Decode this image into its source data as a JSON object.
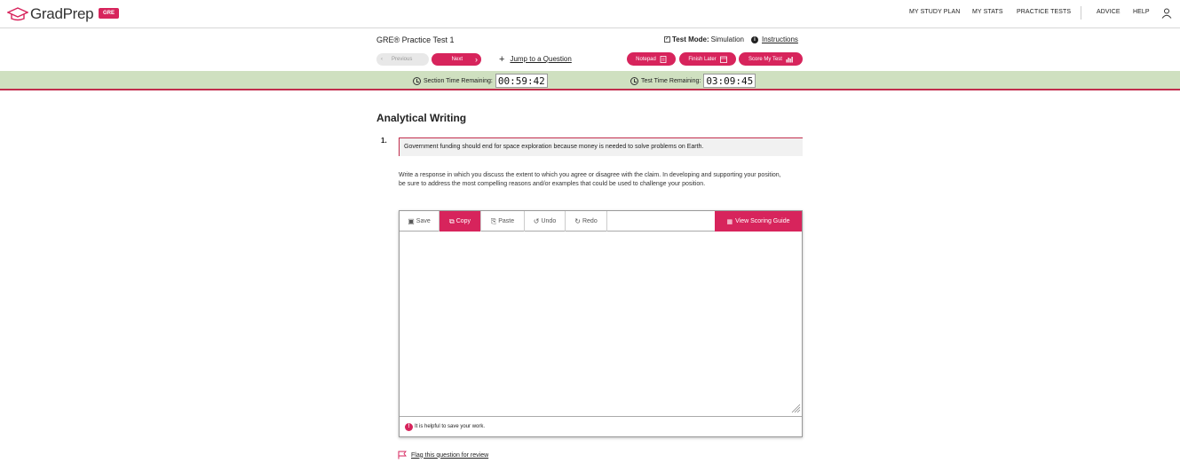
{
  "brand": {
    "logo_text": "GradPrep",
    "badge": "GRE"
  },
  "nav": {
    "items": [
      "MY STUDY PLAN",
      "MY STATS",
      "PRACTICE TESTS",
      "ADVICE",
      "HELP"
    ]
  },
  "test": {
    "title": "GRE® Practice Test 1",
    "mode_label": "Test Mode:",
    "mode_value": "Simulation",
    "instructions": "Instructions",
    "prev_label": "Previous",
    "next_label": "Next",
    "jump_label": "Jump to a Question",
    "notepad_label": "Notepad",
    "finish_label": "Finish Later",
    "score_label": "Score My Test"
  },
  "timers": {
    "section_label": "Section Time Remaining:",
    "section_value": "00:59:42",
    "test_label": "Test Time Remaining:",
    "test_value": "03:09:45"
  },
  "content": {
    "section_title": "Analytical Writing",
    "question_number": "1.",
    "prompt": "Government funding should end for space exploration because money is needed to solve problems on Earth.",
    "directions": "Write a response in which you discuss the extent to which you agree or disagree with the claim. In developing and supporting your position, be sure to address the most compelling reasons and/or examples that could be used to challenge your position."
  },
  "editor": {
    "save": "Save",
    "copy": "Copy",
    "paste": "Paste",
    "undo": "Undo",
    "redo": "Redo",
    "scoring_guide": "View Scoring Guide",
    "response_value": "",
    "footer_note": "It is helpful to save your work."
  },
  "flag_label": "Flag this question for review",
  "colors": {
    "accent": "#d7245c",
    "timer_bg": "#cfe0c0",
    "divider": "#c22d4d"
  }
}
